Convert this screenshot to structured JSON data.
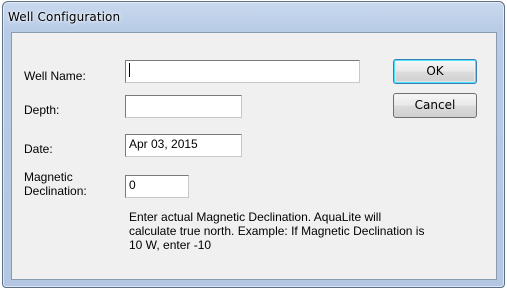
{
  "window": {
    "title": "Well Configuration"
  },
  "form": {
    "well_name_label": "Well Name:",
    "well_name_value": "",
    "depth_label": "Depth:",
    "depth_value": "",
    "date_label": "Date:",
    "date_value": "Apr 03, 2015",
    "declination_label": "Magnetic\nDeclination:",
    "declination_value": "0",
    "declination_note": "Enter actual Magnetic Declination. AquaLite will calculate true north. Example: If Magnetic Declination is 10 W, enter -10"
  },
  "buttons": {
    "ok_label": "OK",
    "cancel_label": "Cancel"
  }
}
